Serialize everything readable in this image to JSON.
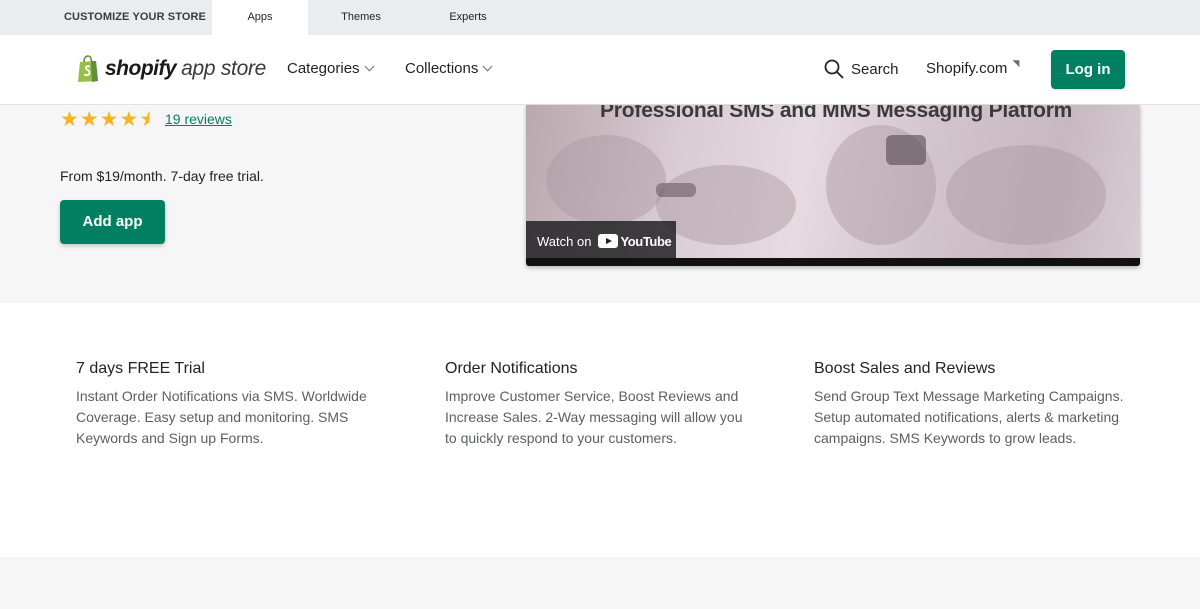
{
  "topbar": {
    "tabs": [
      {
        "label": "CUSTOMIZE YOUR STORE"
      },
      {
        "label": "Apps",
        "active": true
      },
      {
        "label": "Themes"
      },
      {
        "label": "Experts"
      }
    ]
  },
  "header": {
    "logo_bold": "shopify",
    "logo_light": "app store",
    "nav": [
      {
        "label": "Categories",
        "icon": "chevron-down-icon"
      },
      {
        "label": "Collections",
        "icon": "chevron-down-icon"
      }
    ],
    "search_label": "Search",
    "shopify_link": "Shopify.com",
    "login_label": "Log in"
  },
  "hero": {
    "rating": 4.5,
    "reviews_link": "19 reviews",
    "pricing": "From $19/month. 7-day free trial.",
    "add_button": "Add app",
    "video": {
      "headline": "Professional SMS and MMS Messaging Platform",
      "watch_label": "Watch on",
      "youtube_label": "YouTube"
    }
  },
  "features": [
    {
      "title": "7 days FREE Trial",
      "description": "Instant Order Notifications via SMS. Worldwide Coverage. Easy setup and monitoring. SMS Keywords and Sign up Forms."
    },
    {
      "title": "Order Notifications",
      "description": "Improve Customer Service, Boost Reviews and Increase Sales. 2-Way messaging will allow you to quickly respond to your customers."
    },
    {
      "title": "Boost Sales and Reviews",
      "description": "Send Group Text Message Marketing Campaigns. Setup automated notifications, alerts & marketing campaigns. SMS Keywords to grow leads."
    }
  ],
  "colors": {
    "brand_green": "#008060",
    "star": "#f4b524"
  }
}
